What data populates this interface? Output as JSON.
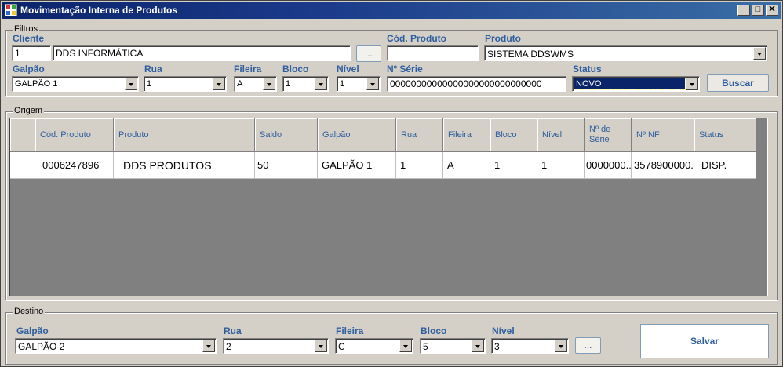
{
  "window": {
    "title": "Movimentação Interna de Produtos",
    "minimize": "_",
    "maximize": "□",
    "close": "✕"
  },
  "filtros": {
    "group_label": "Filtros",
    "cliente_label": "Cliente",
    "cliente_code": "1",
    "cliente_name": "DDS INFORMÁTICA",
    "lookup_button": "...",
    "cod_produto_label": "Cód. Produto",
    "cod_produto_value": "",
    "produto_label": "Produto",
    "produto_value": "SISTEMA DDSWMS",
    "galpao_label": "Galpão",
    "galpao_value": "GALPÃO 1",
    "rua_label": "Rua",
    "rua_value": "1",
    "fileira_label": "Fileira",
    "fileira_value": "A",
    "bloco_label": "Bloco",
    "bloco_value": "1",
    "nivel_label": "Nível",
    "nivel_value": "1",
    "serie_label": "Nº Série",
    "serie_value": "00000000000000000000000000000",
    "status_label": "Status",
    "status_value": "NOVO",
    "buscar_button": "Buscar"
  },
  "origem": {
    "group_label": "Origem",
    "columns": [
      "",
      "Cód. Produto",
      "Produto",
      "Saldo",
      "Galpão",
      "Rua",
      "Fileira",
      "Bloco",
      "Nível",
      "Nº de Série",
      "Nº NF",
      "Status"
    ],
    "rows": [
      [
        "",
        "0006247896",
        "DDS PRODUTOS",
        "50",
        "GALPÃO 1",
        "1",
        "A",
        "1",
        "1",
        "0000000..",
        "3578900000.",
        "DISP."
      ]
    ]
  },
  "destino": {
    "group_label": "Destino",
    "galpao_label": "Galpão",
    "galpao_value": "GALPÃO 2",
    "rua_label": "Rua",
    "rua_value": "2",
    "fileira_label": "Fileira",
    "fileira_value": "C",
    "bloco_label": "Bloco",
    "bloco_value": "5",
    "nivel_label": "Nível",
    "nivel_value": "3",
    "lookup_button": "...",
    "salvar_button": "Salvar"
  }
}
